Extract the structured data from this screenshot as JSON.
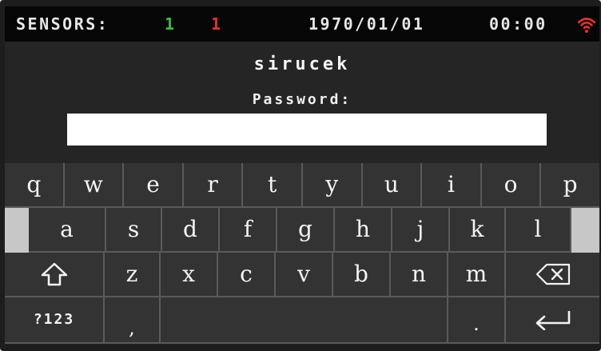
{
  "status": {
    "sensors_label": "SENSORS:",
    "sensor_ok_count": "1",
    "sensor_alert_count": "1",
    "date": "1970/01/01",
    "time": "00:00",
    "wifi_icon": "wifi-icon",
    "colors": {
      "ok": "#38c23a",
      "alert": "#e7322c",
      "wifi": "#e7322c"
    }
  },
  "login": {
    "username": "sirucek",
    "password_label": "Password:",
    "password_value": ""
  },
  "keyboard": {
    "row1": [
      "q",
      "w",
      "e",
      "r",
      "t",
      "y",
      "u",
      "i",
      "o",
      "p"
    ],
    "row2": [
      "a",
      "s",
      "d",
      "f",
      "g",
      "h",
      "j",
      "k",
      "l"
    ],
    "row3": [
      "z",
      "x",
      "c",
      "v",
      "b",
      "n",
      "m"
    ],
    "shift_icon": "shift-icon",
    "backspace_icon": "backspace-icon",
    "numbers_label": "?123",
    "comma_label": ",",
    "period_label": ".",
    "enter_icon": "enter-icon"
  }
}
